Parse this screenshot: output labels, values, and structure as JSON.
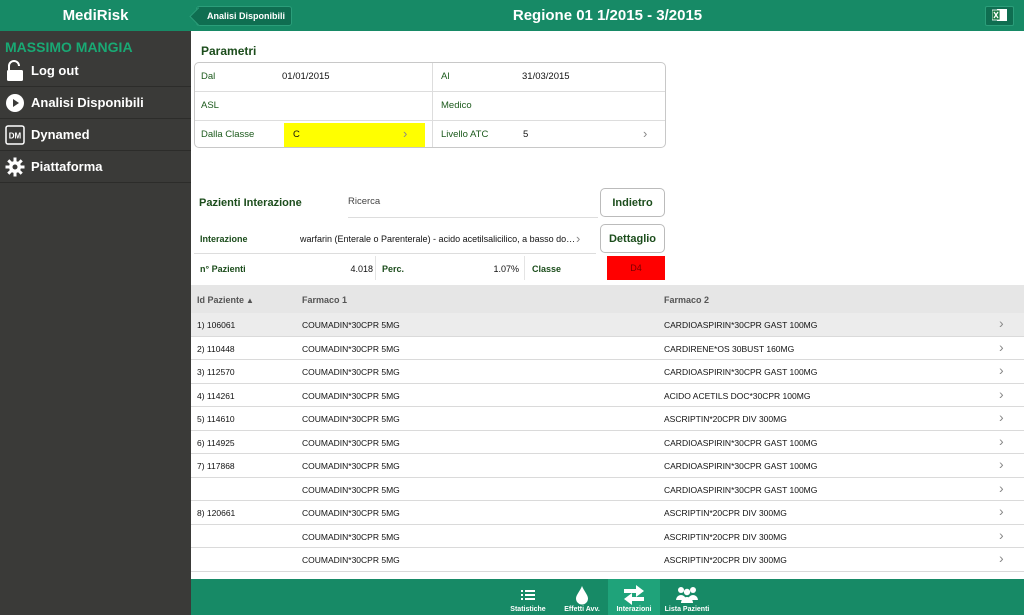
{
  "app": {
    "title": "MediRisk",
    "user": "MASSIMO MANGIA"
  },
  "sidebar": {
    "items": [
      {
        "label": "Log out",
        "icon": "unlock-icon"
      },
      {
        "label": "Analisi Disponibili",
        "icon": "play-circle-icon"
      },
      {
        "label": "Dynamed",
        "icon": "dm-icon"
      },
      {
        "label": "Piattaforma",
        "icon": "gear-icon"
      }
    ]
  },
  "header": {
    "back_label": "Analisi Disponibili",
    "title": "Regione 01 1/2015 - 3/2015",
    "excel_icon": "excel-icon"
  },
  "parametri": {
    "title": "Parametri",
    "dal_label": "Dal",
    "dal_value": "01/01/2015",
    "al_label": "Al",
    "al_value": "31/03/2015",
    "asl_label": "ASL",
    "asl_value": "",
    "medico_label": "Medico",
    "medico_value": "",
    "classe_label": "Dalla Classe",
    "classe_value": "C",
    "atc_label": "Livello ATC",
    "atc_value": "5"
  },
  "interazione": {
    "title": "Pazienti Interazione",
    "ricerca_label": "Ricerca",
    "indietro_label": "Indietro",
    "dettaglio_label": "Dettaglio",
    "label": "Interazione",
    "value": "warfarin (Enterale o Parenterale) - acido acetilsalicilico, a basso dosaggio",
    "npazienti_label": "n° Pazienti",
    "npazienti_value": "4.018",
    "perc_label": "Perc.",
    "perc_value": "1.07%",
    "classe_label": "Classe",
    "classe_value": "D4",
    "classe_color": "#ff0000"
  },
  "table": {
    "headers": {
      "id": "Id Paziente",
      "f1": "Farmaco 1",
      "f2": "Farmaco 2"
    },
    "rows": [
      {
        "id": "1) 106061",
        "f1": "COUMADIN*30CPR 5MG",
        "f2": "CARDIOASPIRIN*30CPR GAST 100MG"
      },
      {
        "id": "2) 110448",
        "f1": "COUMADIN*30CPR 5MG",
        "f2": "CARDIRENE*OS 30BUST 160MG"
      },
      {
        "id": "3) 112570",
        "f1": "COUMADIN*30CPR 5MG",
        "f2": "CARDIOASPIRIN*30CPR GAST 100MG"
      },
      {
        "id": "4) 114261",
        "f1": "COUMADIN*30CPR 5MG",
        "f2": "ACIDO ACETILS DOC*30CPR 100MG"
      },
      {
        "id": "5) 114610",
        "f1": "COUMADIN*30CPR 5MG",
        "f2": "ASCRIPTIN*20CPR DIV 300MG"
      },
      {
        "id": "6) 114925",
        "f1": "COUMADIN*30CPR 5MG",
        "f2": "CARDIOASPIRIN*30CPR GAST 100MG"
      },
      {
        "id": "7) 117868",
        "f1": "COUMADIN*30CPR 5MG",
        "f2": "CARDIOASPIRIN*30CPR GAST 100MG"
      },
      {
        "id": "",
        "f1": "COUMADIN*30CPR 5MG",
        "f2": "CARDIOASPIRIN*30CPR GAST 100MG"
      },
      {
        "id": "8) 120661",
        "f1": "COUMADIN*30CPR 5MG",
        "f2": "ASCRIPTIN*20CPR DIV 300MG"
      },
      {
        "id": "",
        "f1": "COUMADIN*30CPR 5MG",
        "f2": "ASCRIPTIN*20CPR DIV 300MG"
      },
      {
        "id": "",
        "f1": "COUMADIN*30CPR 5MG",
        "f2": "ASCRIPTIN*20CPR DIV 300MG"
      }
    ]
  },
  "bottom_tabs": [
    {
      "label": "Statistiche",
      "icon": "list-icon"
    },
    {
      "label": "Effetti Avv.",
      "icon": "drop-icon"
    },
    {
      "label": "Interazioni",
      "icon": "arrows-icon",
      "active": true
    },
    {
      "label": "Lista Pazienti",
      "icon": "people-icon"
    }
  ],
  "colors": {
    "brand": "#178a66",
    "sidebar": "#3a3a38",
    "highlight": "#ffff00",
    "user": "#19a974"
  }
}
